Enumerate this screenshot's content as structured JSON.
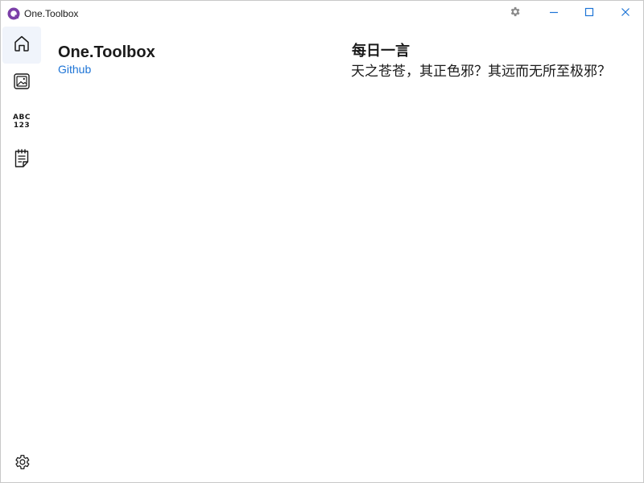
{
  "titlebar": {
    "app_title": "One.Toolbox",
    "icons": {
      "app": "app-logo-icon",
      "settings": "gear-icon",
      "minimize": "minimize-icon",
      "maximize": "maximize-icon",
      "close": "close-icon"
    },
    "colors": {
      "app_icon": "#7b3fa8",
      "window_controls": "#1d74d6",
      "settings": "#8a8a8a"
    }
  },
  "nav": {
    "items": [
      {
        "icon": "home-icon",
        "selected": true
      },
      {
        "icon": "image-icon",
        "selected": false
      },
      {
        "icon": "abc-123-icon",
        "glyph_top": "ABC",
        "glyph_bottom": "123",
        "selected": false
      },
      {
        "icon": "notes-icon",
        "selected": false
      }
    ],
    "footer": {
      "icon": "settings-icon"
    }
  },
  "main": {
    "title": "One.Toolbox",
    "github_link": "Github",
    "link_color": "#1d74d6",
    "quote": {
      "heading": "每日一言",
      "text": "天之苍苍，其正色邪？其远而无所至极邪？"
    }
  }
}
